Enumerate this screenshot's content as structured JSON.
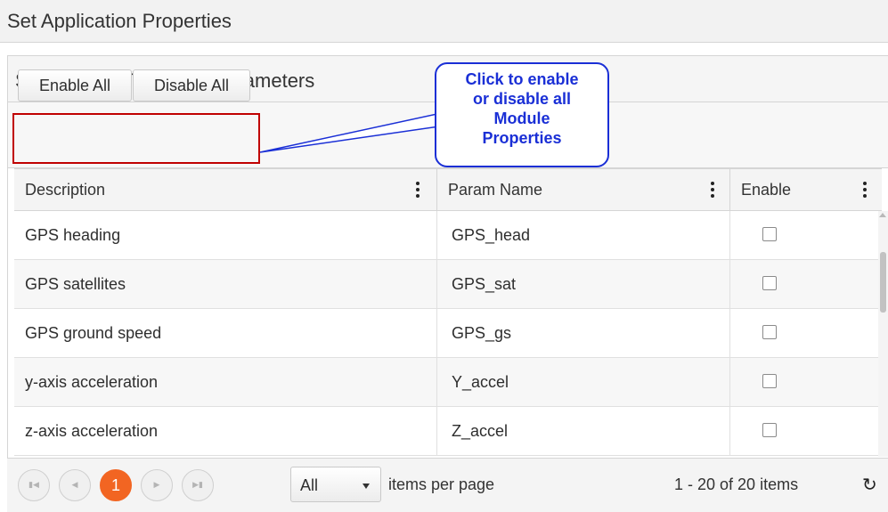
{
  "header": {
    "title": "Set Application Properties"
  },
  "panel": {
    "title": "Select CL-T07-108-10 Parameters"
  },
  "toolbar": {
    "enable_all_label": "Enable All",
    "disable_all_label": "Disable All"
  },
  "callout": {
    "lines": [
      "Click to enable",
      "or disable all",
      "Module",
      "Properties"
    ],
    "color": "#1a2fd6",
    "highlight_color": "#c00000"
  },
  "grid": {
    "columns": [
      "Description",
      "Param Name",
      "Enable"
    ],
    "column_menu_icon": "vertical-dots-icon",
    "rows": [
      {
        "description": "GPS heading",
        "param": "GPS_head",
        "enabled": false
      },
      {
        "description": "GPS satellites",
        "param": "GPS_sat",
        "enabled": false
      },
      {
        "description": "GPS ground speed",
        "param": "GPS_gs",
        "enabled": false
      },
      {
        "description": "y-axis acceleration",
        "param": "Y_accel",
        "enabled": false
      },
      {
        "description": "z-axis acceleration",
        "param": "Z_accel",
        "enabled": false
      }
    ]
  },
  "pager": {
    "first_icon": "first-page-icon",
    "prev_icon": "prev-page-icon",
    "current_page": "1",
    "next_icon": "next-page-icon",
    "last_icon": "last-page-icon",
    "page_size": "All",
    "page_size_label": "items per page",
    "info": "1 - 20 of 20 items",
    "refresh_icon": "refresh-icon",
    "accent_color": "#f26522"
  }
}
